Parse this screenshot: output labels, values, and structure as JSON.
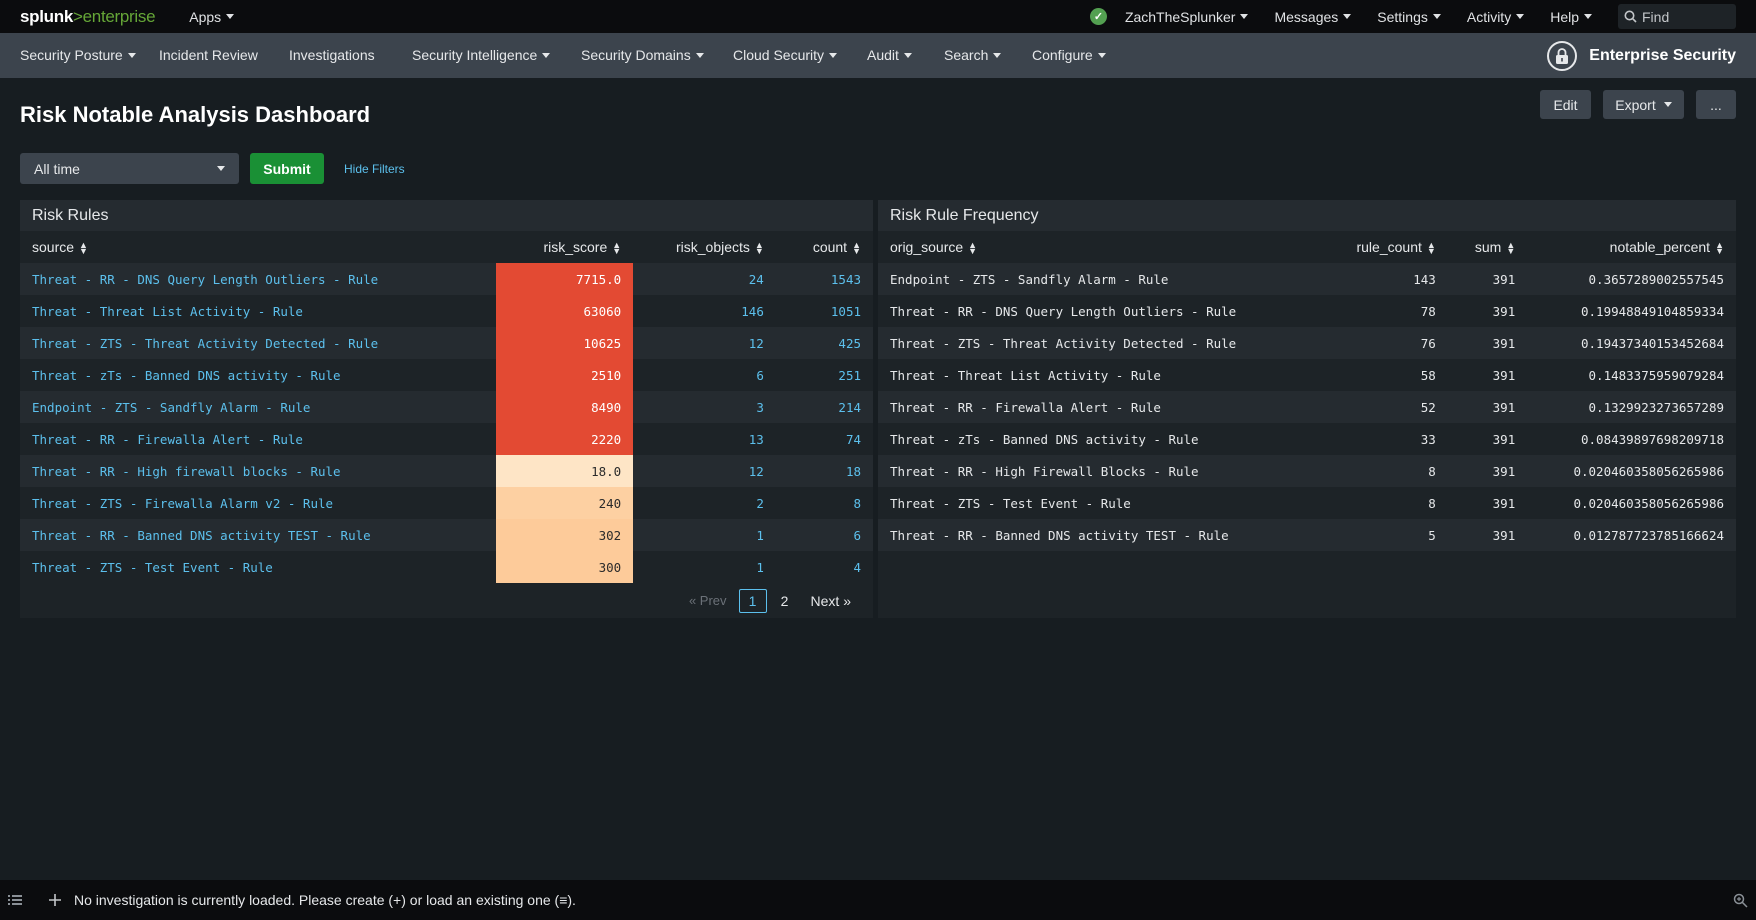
{
  "topbar": {
    "logo_brand": "splunk",
    "logo_gt": ">",
    "logo_product": "enterprise",
    "apps_label": "Apps",
    "user_label": "ZachTheSplunker",
    "messages_label": "Messages",
    "settings_label": "Settings",
    "activity_label": "Activity",
    "help_label": "Help",
    "find_label": "Find"
  },
  "appbar": {
    "items": [
      {
        "label": "Security Posture",
        "dropdown": true
      },
      {
        "label": "Incident Review",
        "dropdown": false
      },
      {
        "label": "Investigations",
        "dropdown": false
      },
      {
        "label": "Security Intelligence",
        "dropdown": true
      },
      {
        "label": "Security Domains",
        "dropdown": true
      },
      {
        "label": "Cloud Security",
        "dropdown": true
      },
      {
        "label": "Audit",
        "dropdown": true
      },
      {
        "label": "Search",
        "dropdown": true
      },
      {
        "label": "Configure",
        "dropdown": true
      }
    ],
    "app_name": "Enterprise Security"
  },
  "header": {
    "title": "Risk Notable Analysis Dashboard",
    "edit_label": "Edit",
    "export_label": "Export",
    "more_label": "..."
  },
  "filters": {
    "time_value": "All time",
    "submit_label": "Submit",
    "hide_filters_label": "Hide Filters"
  },
  "risk_rules": {
    "title": "Risk Rules",
    "columns": [
      "source",
      "risk_score",
      "risk_objects",
      "count"
    ],
    "rows": [
      {
        "source": "Threat - RR - DNS Query Length Outliers - Rule",
        "risk_score": "7715.0",
        "risk_objects": "24",
        "count": "1543"
      },
      {
        "source": "Threat - Threat List Activity - Rule",
        "risk_score": "63060",
        "risk_objects": "146",
        "count": "1051"
      },
      {
        "source": "Threat - ZTS - Threat Activity Detected - Rule",
        "risk_score": "10625",
        "risk_objects": "12",
        "count": "425"
      },
      {
        "source": "Threat - zTs - Banned DNS activity - Rule",
        "risk_score": "2510",
        "risk_objects": "6",
        "count": "251"
      },
      {
        "source": "Endpoint - ZTS - Sandfly Alarm - Rule",
        "risk_score": "8490",
        "risk_objects": "3",
        "count": "214"
      },
      {
        "source": "Threat - RR - Firewalla Alert - Rule",
        "risk_score": "2220",
        "risk_objects": "13",
        "count": "74"
      },
      {
        "source": "Threat - RR - High firewall blocks - Rule",
        "risk_score": "18.0",
        "risk_objects": "12",
        "count": "18"
      },
      {
        "source": "Threat - ZTS - Firewalla Alarm v2 - Rule",
        "risk_score": "240",
        "risk_objects": "2",
        "count": "8"
      },
      {
        "source": "Threat - RR - Banned DNS activity TEST - Rule",
        "risk_score": "302",
        "risk_objects": "1",
        "count": "6"
      },
      {
        "source": "Threat - ZTS - Test Event - Rule",
        "risk_score": "300",
        "risk_objects": "1",
        "count": "4"
      }
    ],
    "heat_colors": [
      "#e34a33",
      "#e34a33",
      "#e34a33",
      "#e34a33",
      "#e34a33",
      "#e34a33",
      "#fee5c6",
      "#fdd0a2",
      "#fdcb9a",
      "#fdcb9a"
    ],
    "heat_text_dark": [
      "#ffffff",
      "#ffffff",
      "#ffffff",
      "#ffffff",
      "#ffffff",
      "#ffffff",
      "#2b2b2b",
      "#2b2b2b",
      "#2b2b2b",
      "#2b2b2b"
    ],
    "pager": {
      "prev_label": "« Prev",
      "pages": [
        "1",
        "2"
      ],
      "next_label": "Next »"
    }
  },
  "frequency": {
    "title": "Risk Rule Frequency",
    "columns": [
      "orig_source",
      "rule_count",
      "sum",
      "notable_percent"
    ],
    "rows": [
      {
        "orig_source": "Endpoint - ZTS - Sandfly Alarm - Rule",
        "rule_count": "143",
        "sum": "391",
        "notable_percent": "0.3657289002557545"
      },
      {
        "orig_source": "Threat - RR - DNS Query Length Outliers - Rule",
        "rule_count": "78",
        "sum": "391",
        "notable_percent": "0.19948849104859334"
      },
      {
        "orig_source": "Threat - ZTS - Threat Activity Detected - Rule",
        "rule_count": "76",
        "sum": "391",
        "notable_percent": "0.19437340153452684"
      },
      {
        "orig_source": "Threat - Threat List Activity - Rule",
        "rule_count": "58",
        "sum": "391",
        "notable_percent": "0.1483375959079284"
      },
      {
        "orig_source": "Threat - RR - Firewalla Alert - Rule",
        "rule_count": "52",
        "sum": "391",
        "notable_percent": "0.1329923273657289"
      },
      {
        "orig_source": "Threat - zTs - Banned DNS activity - Rule",
        "rule_count": "33",
        "sum": "391",
        "notable_percent": "0.08439897698209718"
      },
      {
        "orig_source": "Threat - RR - High Firewall Blocks - Rule",
        "rule_count": "8",
        "sum": "391",
        "notable_percent": "0.020460358056265986"
      },
      {
        "orig_source": "Threat - ZTS - Test Event - Rule",
        "rule_count": "8",
        "sum": "391",
        "notable_percent": "0.020460358056265986"
      },
      {
        "orig_source": "Threat - RR - Banned DNS activity TEST - Rule",
        "rule_count": "5",
        "sum": "391",
        "notable_percent": "0.012787723785166624"
      }
    ]
  },
  "bottombar": {
    "message": "No investigation is currently loaded. Please create (+) or load an existing one (≡)."
  },
  "colors": {
    "accent_link": "#5cc0ed",
    "submit_green": "#1a9035",
    "status_green": "#53a051"
  }
}
